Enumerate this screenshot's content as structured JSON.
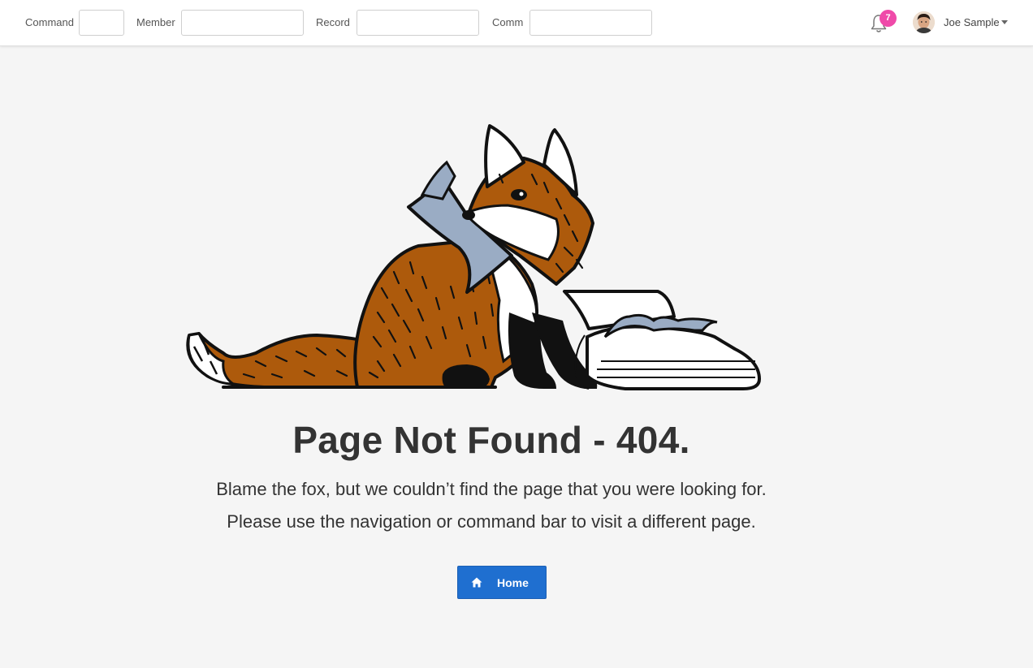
{
  "header": {
    "fields": [
      {
        "label": "Command",
        "value": ""
      },
      {
        "label": "Member",
        "value": ""
      },
      {
        "label": "Record",
        "value": ""
      },
      {
        "label": "Comm",
        "value": ""
      }
    ],
    "notifications": {
      "icon": "bell-icon",
      "count": "7",
      "badge_color": "#ef4aa9"
    },
    "user": {
      "name": "Joe Sample",
      "avatar": "user-avatar",
      "menu_icon": "caret-down-icon"
    }
  },
  "main": {
    "illustration": "fox-reading-book",
    "title": "Page Not Found - 404.",
    "message_line1": "Blame the fox, but we couldn’t find the page that you were looking for.",
    "message_line2": "Please use the navigation or command bar to visit a different page.",
    "home_button": {
      "label": "Home",
      "icon": "home-icon",
      "color": "#1f6fd0"
    }
  }
}
